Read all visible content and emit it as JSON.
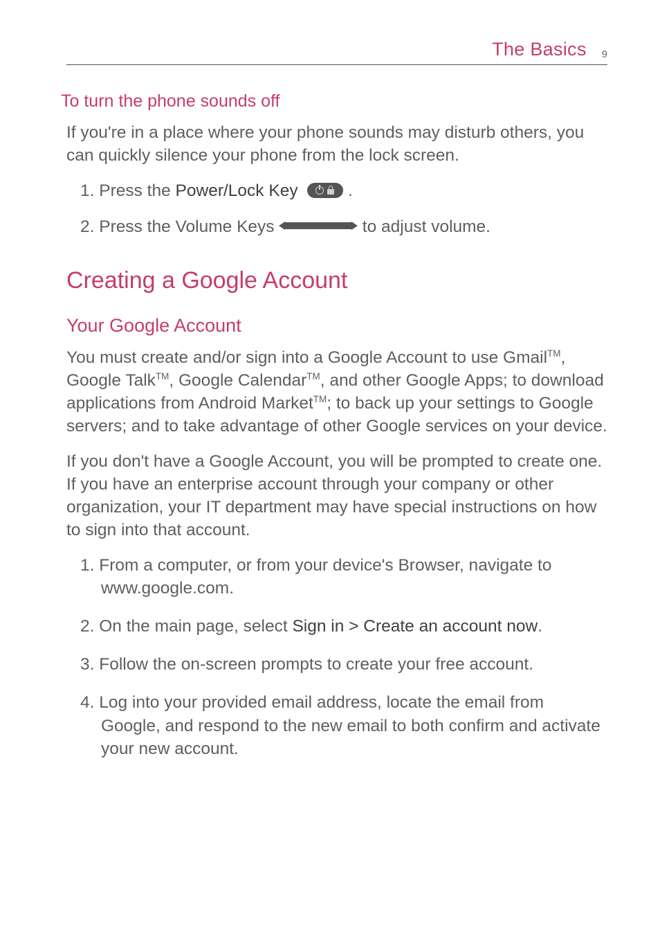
{
  "header": {
    "title": "The Basics",
    "page": "9"
  },
  "section1": {
    "title": "To turn the phone sounds off",
    "intro": "If you're in a place where your phone sounds may disturb others, you can quickly silence your phone from the lock screen.",
    "step1_pre": "1. Press the ",
    "step1_bold": "Power/Lock Key",
    "step1_post": " .",
    "step2_pre": "2. Press the Volume Keys ",
    "step2_post": " to adjust volume."
  },
  "section2": {
    "title": "Creating a Google Account",
    "sub": "Your Google Account",
    "para1_a": "You must create and/or sign into a Google Account to use Gmail",
    "para1_b": ", Google Talk",
    "para1_c": ", Google Calendar",
    "para1_d": ", and other Google Apps; to download applications from Android Market",
    "para1_e": "; to back up your settings to Google servers; and to take advantage of other Google services on your device.",
    "para2": "If you don't have a Google Account, you will be prompted to create one. If you have an enterprise account through your company or other organization, your IT department may have special instructions on how to sign into that account.",
    "steps": {
      "s1": "1. From a computer, or from your device's Browser, navigate to www.google.com.",
      "s2_pre": "2. On the main page, select ",
      "s2_bold": "Sign in > Create an account now",
      "s2_post": ".",
      "s3": "3. Follow the on-screen prompts to create your free account.",
      "s4": "4. Log into your provided email address, locate the email from Google, and respond to the new email to both confirm and activate your new account."
    }
  },
  "glyphs": {
    "tm": "TM"
  }
}
